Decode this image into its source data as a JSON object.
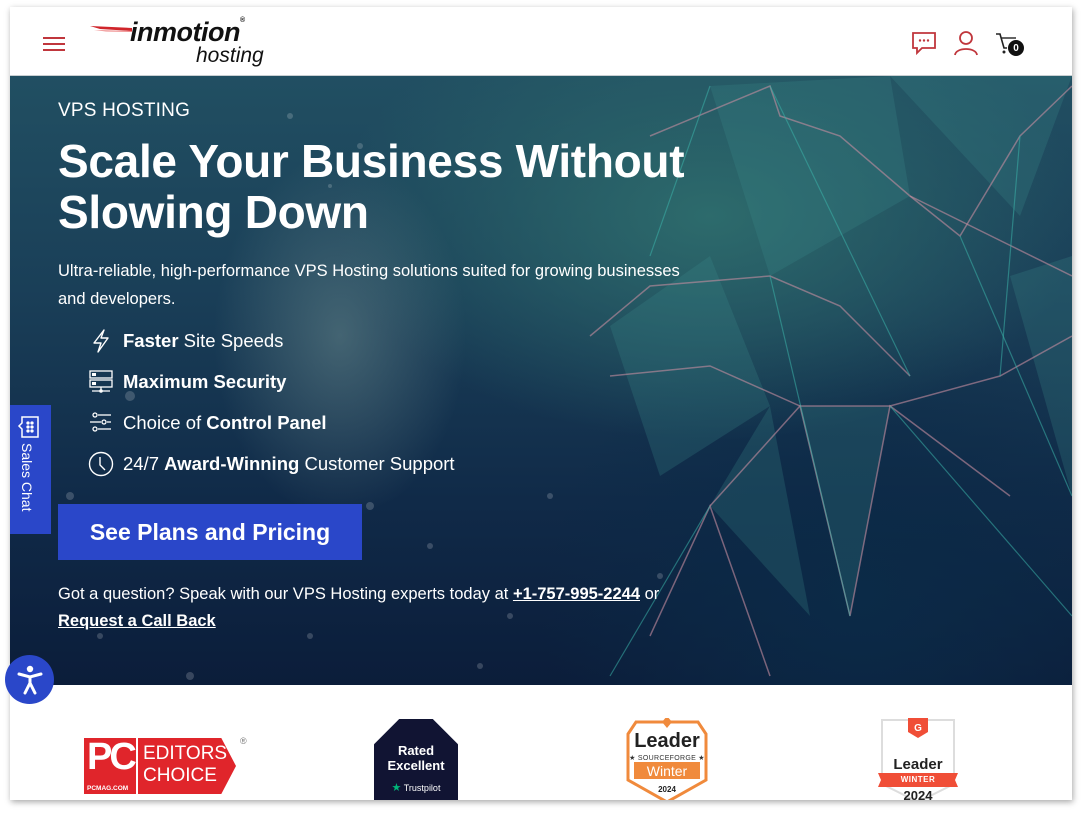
{
  "header": {
    "menu_icon": "hamburger-menu-icon",
    "logo": {
      "brand": "inmotion",
      "registered": "®",
      "sub": "hosting"
    },
    "icons": [
      "chat-icon",
      "user-icon",
      "cart-icon"
    ],
    "cart_count": "0",
    "accent_color": "#c0363c"
  },
  "hero": {
    "eyebrow": "VPS HOSTING",
    "headline": "Scale Your Business Without Slowing Down",
    "lead": "Ultra-reliable, high-performance VPS Hosting solutions suited for growing businesses and developers.",
    "features": [
      {
        "icon": "lightning-icon",
        "bold": "Faster",
        "rest": " Site Speeds",
        "pre": ""
      },
      {
        "icon": "server-icon",
        "bold": "Maximum Security",
        "rest": "",
        "pre": ""
      },
      {
        "icon": "sliders-icon",
        "pre": "Choice of ",
        "bold": "Control Panel",
        "rest": ""
      },
      {
        "icon": "clock-icon",
        "pre": "24/7 ",
        "bold": "Award-Winning",
        "rest": " Customer Support"
      }
    ],
    "cta_label": "See Plans and Pricing",
    "cta_color": "#2a47c9",
    "contact": {
      "prefix": "Got a question? Speak with our VPS Hosting experts today at ",
      "phone": "+1-757-995-2244",
      "middle": " or ",
      "callback": "Request a Call Back"
    }
  },
  "sales_chat": {
    "label": "Sales Chat"
  },
  "accessibility": {
    "icon": "accessibility-icon"
  },
  "awards": {
    "pcmag": {
      "pc": "PC",
      "site": "PCMAG.COM",
      "line1": "EDITORS’",
      "line2": "CHOICE",
      "reg": "®"
    },
    "trustpilot": {
      "line1": "Rated",
      "line2": "Excellent",
      "brand": "Trustpilot"
    },
    "sourceforge": {
      "title": "Leader",
      "brand": "★ SOURCEFORGE ★",
      "season": "Winter",
      "year": "2024"
    },
    "g2": {
      "title": "Leader",
      "season": "WINTER",
      "year": "2024"
    }
  }
}
